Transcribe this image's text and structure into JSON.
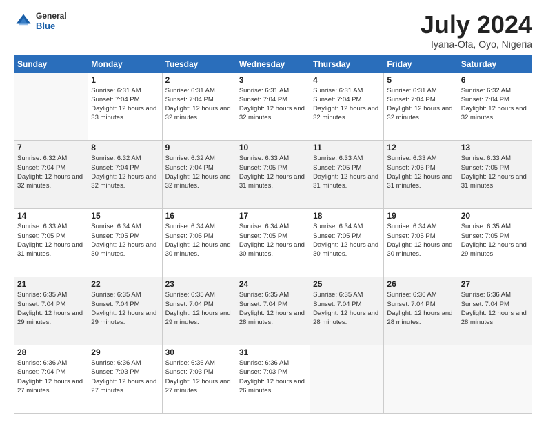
{
  "header": {
    "logo_general": "General",
    "logo_blue": "Blue",
    "month": "July 2024",
    "location": "Iyana-Ofa, Oyo, Nigeria"
  },
  "days_of_week": [
    "Sunday",
    "Monday",
    "Tuesday",
    "Wednesday",
    "Thursday",
    "Friday",
    "Saturday"
  ],
  "weeks": [
    [
      {
        "day": "",
        "sunrise": "",
        "sunset": "",
        "daylight": ""
      },
      {
        "day": "1",
        "sunrise": "Sunrise: 6:31 AM",
        "sunset": "Sunset: 7:04 PM",
        "daylight": "Daylight: 12 hours and 33 minutes."
      },
      {
        "day": "2",
        "sunrise": "Sunrise: 6:31 AM",
        "sunset": "Sunset: 7:04 PM",
        "daylight": "Daylight: 12 hours and 32 minutes."
      },
      {
        "day": "3",
        "sunrise": "Sunrise: 6:31 AM",
        "sunset": "Sunset: 7:04 PM",
        "daylight": "Daylight: 12 hours and 32 minutes."
      },
      {
        "day": "4",
        "sunrise": "Sunrise: 6:31 AM",
        "sunset": "Sunset: 7:04 PM",
        "daylight": "Daylight: 12 hours and 32 minutes."
      },
      {
        "day": "5",
        "sunrise": "Sunrise: 6:31 AM",
        "sunset": "Sunset: 7:04 PM",
        "daylight": "Daylight: 12 hours and 32 minutes."
      },
      {
        "day": "6",
        "sunrise": "Sunrise: 6:32 AM",
        "sunset": "Sunset: 7:04 PM",
        "daylight": "Daylight: 12 hours and 32 minutes."
      }
    ],
    [
      {
        "day": "7",
        "sunrise": "Sunrise: 6:32 AM",
        "sunset": "Sunset: 7:04 PM",
        "daylight": "Daylight: 12 hours and 32 minutes."
      },
      {
        "day": "8",
        "sunrise": "Sunrise: 6:32 AM",
        "sunset": "Sunset: 7:04 PM",
        "daylight": "Daylight: 12 hours and 32 minutes."
      },
      {
        "day": "9",
        "sunrise": "Sunrise: 6:32 AM",
        "sunset": "Sunset: 7:04 PM",
        "daylight": "Daylight: 12 hours and 32 minutes."
      },
      {
        "day": "10",
        "sunrise": "Sunrise: 6:33 AM",
        "sunset": "Sunset: 7:05 PM",
        "daylight": "Daylight: 12 hours and 31 minutes."
      },
      {
        "day": "11",
        "sunrise": "Sunrise: 6:33 AM",
        "sunset": "Sunset: 7:05 PM",
        "daylight": "Daylight: 12 hours and 31 minutes."
      },
      {
        "day": "12",
        "sunrise": "Sunrise: 6:33 AM",
        "sunset": "Sunset: 7:05 PM",
        "daylight": "Daylight: 12 hours and 31 minutes."
      },
      {
        "day": "13",
        "sunrise": "Sunrise: 6:33 AM",
        "sunset": "Sunset: 7:05 PM",
        "daylight": "Daylight: 12 hours and 31 minutes."
      }
    ],
    [
      {
        "day": "14",
        "sunrise": "Sunrise: 6:33 AM",
        "sunset": "Sunset: 7:05 PM",
        "daylight": "Daylight: 12 hours and 31 minutes."
      },
      {
        "day": "15",
        "sunrise": "Sunrise: 6:34 AM",
        "sunset": "Sunset: 7:05 PM",
        "daylight": "Daylight: 12 hours and 30 minutes."
      },
      {
        "day": "16",
        "sunrise": "Sunrise: 6:34 AM",
        "sunset": "Sunset: 7:05 PM",
        "daylight": "Daylight: 12 hours and 30 minutes."
      },
      {
        "day": "17",
        "sunrise": "Sunrise: 6:34 AM",
        "sunset": "Sunset: 7:05 PM",
        "daylight": "Daylight: 12 hours and 30 minutes."
      },
      {
        "day": "18",
        "sunrise": "Sunrise: 6:34 AM",
        "sunset": "Sunset: 7:05 PM",
        "daylight": "Daylight: 12 hours and 30 minutes."
      },
      {
        "day": "19",
        "sunrise": "Sunrise: 6:34 AM",
        "sunset": "Sunset: 7:05 PM",
        "daylight": "Daylight: 12 hours and 30 minutes."
      },
      {
        "day": "20",
        "sunrise": "Sunrise: 6:35 AM",
        "sunset": "Sunset: 7:05 PM",
        "daylight": "Daylight: 12 hours and 29 minutes."
      }
    ],
    [
      {
        "day": "21",
        "sunrise": "Sunrise: 6:35 AM",
        "sunset": "Sunset: 7:04 PM",
        "daylight": "Daylight: 12 hours and 29 minutes."
      },
      {
        "day": "22",
        "sunrise": "Sunrise: 6:35 AM",
        "sunset": "Sunset: 7:04 PM",
        "daylight": "Daylight: 12 hours and 29 minutes."
      },
      {
        "day": "23",
        "sunrise": "Sunrise: 6:35 AM",
        "sunset": "Sunset: 7:04 PM",
        "daylight": "Daylight: 12 hours and 29 minutes."
      },
      {
        "day": "24",
        "sunrise": "Sunrise: 6:35 AM",
        "sunset": "Sunset: 7:04 PM",
        "daylight": "Daylight: 12 hours and 28 minutes."
      },
      {
        "day": "25",
        "sunrise": "Sunrise: 6:35 AM",
        "sunset": "Sunset: 7:04 PM",
        "daylight": "Daylight: 12 hours and 28 minutes."
      },
      {
        "day": "26",
        "sunrise": "Sunrise: 6:36 AM",
        "sunset": "Sunset: 7:04 PM",
        "daylight": "Daylight: 12 hours and 28 minutes."
      },
      {
        "day": "27",
        "sunrise": "Sunrise: 6:36 AM",
        "sunset": "Sunset: 7:04 PM",
        "daylight": "Daylight: 12 hours and 28 minutes."
      }
    ],
    [
      {
        "day": "28",
        "sunrise": "Sunrise: 6:36 AM",
        "sunset": "Sunset: 7:04 PM",
        "daylight": "Daylight: 12 hours and 27 minutes."
      },
      {
        "day": "29",
        "sunrise": "Sunrise: 6:36 AM",
        "sunset": "Sunset: 7:03 PM",
        "daylight": "Daylight: 12 hours and 27 minutes."
      },
      {
        "day": "30",
        "sunrise": "Sunrise: 6:36 AM",
        "sunset": "Sunset: 7:03 PM",
        "daylight": "Daylight: 12 hours and 27 minutes."
      },
      {
        "day": "31",
        "sunrise": "Sunrise: 6:36 AM",
        "sunset": "Sunset: 7:03 PM",
        "daylight": "Daylight: 12 hours and 26 minutes."
      },
      {
        "day": "",
        "sunrise": "",
        "sunset": "",
        "daylight": ""
      },
      {
        "day": "",
        "sunrise": "",
        "sunset": "",
        "daylight": ""
      },
      {
        "day": "",
        "sunrise": "",
        "sunset": "",
        "daylight": ""
      }
    ]
  ]
}
